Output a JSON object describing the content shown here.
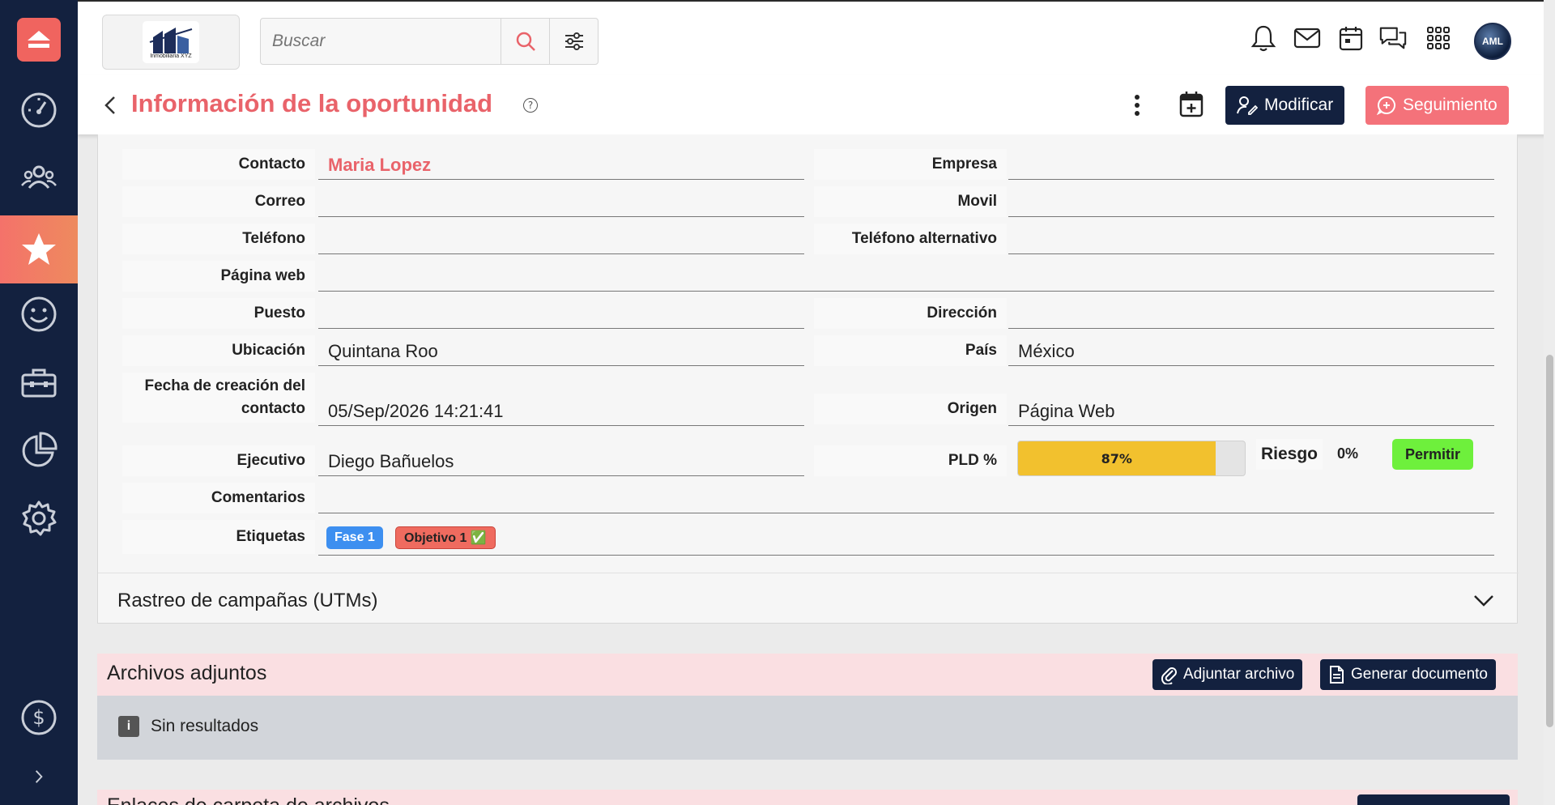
{
  "search": {
    "placeholder": "Buscar"
  },
  "brand": {
    "text": "Inmobiliaria XYZ"
  },
  "user": {
    "initials": "AML"
  },
  "header": {
    "title": "Información de la oportunidad",
    "help": "?",
    "modify_label": "Modificar",
    "followup_label": "Seguimiento"
  },
  "fields": {
    "contacto": {
      "label": "Contacto",
      "value": "Maria Lopez"
    },
    "empresa": {
      "label": "Empresa",
      "value": ""
    },
    "correo": {
      "label": "Correo",
      "value": ""
    },
    "movil": {
      "label": "Movil",
      "value": ""
    },
    "telefono": {
      "label": "Teléfono",
      "value": ""
    },
    "telefono_alt": {
      "label": "Teléfono alternativo",
      "value": ""
    },
    "pagina_web": {
      "label": "Página web",
      "value": ""
    },
    "puesto": {
      "label": "Puesto",
      "value": ""
    },
    "direccion": {
      "label": "Dirección",
      "value": ""
    },
    "ubicacion": {
      "label": "Ubicación",
      "value": "Quintana Roo"
    },
    "pais": {
      "label": "País",
      "value": "México"
    },
    "fecha_creacion": {
      "label": "Fecha de creación del contacto",
      "value": "05/Sep/2026 14:21:41"
    },
    "origen": {
      "label": "Origen",
      "value": "Página Web"
    },
    "ejecutivo": {
      "label": "Ejecutivo",
      "value": "Diego Bañuelos"
    },
    "pld": {
      "label": "PLD %",
      "value": "87%",
      "fraction": 0.87
    },
    "riesgo": {
      "label": "Riesgo",
      "value": "0%"
    },
    "permitir": {
      "label": "Permitir",
      "color": "#6ef03c"
    },
    "comentarios": {
      "label": "Comentarios",
      "value": ""
    },
    "etiquetas": {
      "label": "Etiquetas"
    }
  },
  "tags": [
    {
      "label": "Fase 1",
      "color": "#3d8ff0"
    },
    {
      "label": "Objetivo 1 ✅",
      "color": "#ef6b5f"
    }
  ],
  "utm": {
    "label": "Rastreo de campañas (UTMs)"
  },
  "attachments": {
    "title": "Archivos adjuntos",
    "attach_label": "Adjuntar archivo",
    "generate_label": "Generar documento",
    "empty": "Sin resultados"
  },
  "next_section": {
    "title": "Enlaces de carpeta de archivos"
  },
  "colors": {
    "accent": "#e9636a",
    "navy": "#13213f"
  }
}
